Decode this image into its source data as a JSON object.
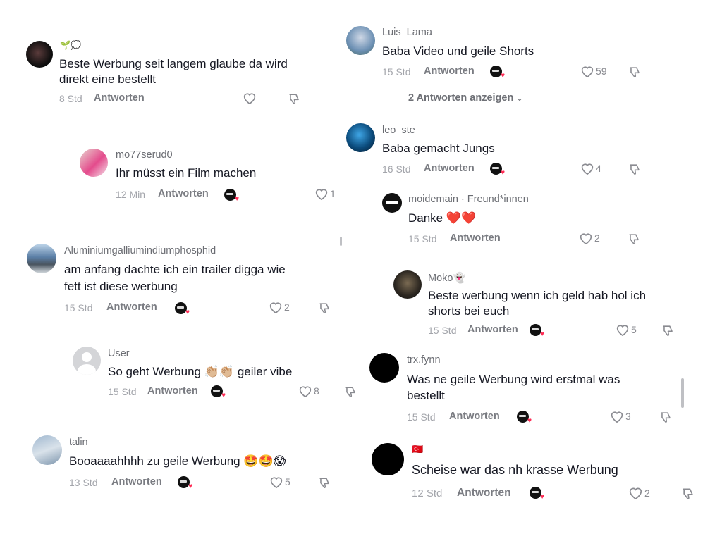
{
  "left": [
    {
      "avatar": "dark-image",
      "flag": "🌱💭",
      "name": "",
      "text1": "Beste Werbung seit langem glaube da wird",
      "text2": "direkt eine bestellt",
      "time": "8 Std",
      "reply": "Antworten",
      "likes": ""
    },
    {
      "avatar": "pink-photo",
      "name": "mo77serud0",
      "text1": "Ihr müsst ein Film machen",
      "time": "12 Min",
      "reply": "Antworten",
      "likes": "1"
    },
    {
      "avatar": "sky-photo",
      "name": "Aluminiumgalliumindiumphosphid",
      "text1": "am anfang dachte ich ein trailer digga wie",
      "text2": "fett ist diese werbung",
      "time": "15 Std",
      "reply": "Antworten",
      "likes": "2"
    },
    {
      "avatar": "default-user",
      "name": "User",
      "text1": "So geht Werbung",
      "emoji": "👏🏼👏🏼",
      "text_after": "geiler vibe",
      "time": "15 Std",
      "reply": "Antworten",
      "likes": "8"
    },
    {
      "avatar": "blue-photo",
      "name": "talin",
      "text1": "Booaaaahhhh zu geile Werbung",
      "emoji": "🤩🤩😱",
      "time": "13 Std",
      "reply": "Antworten",
      "likes": "5"
    }
  ],
  "right": [
    {
      "avatar": "person-photo",
      "name": "Luis_Lama",
      "text1": "Baba Video und geile Shorts",
      "time": "15 Std",
      "reply": "Antworten",
      "likes": "59",
      "more_replies": "2 Antworten anzeigen"
    },
    {
      "avatar": "blue-dark-photo",
      "name": "leo_ste",
      "text1": "Baba gemacht Jungs",
      "time": "16 Std",
      "reply": "Antworten",
      "likes": "4"
    },
    {
      "avatar": "brand-logo",
      "name": "moidemain",
      "tag": "· Freund*innen",
      "text1": "Danke",
      "emoji": "❤️❤️",
      "time": "15 Std",
      "reply": "Antworten",
      "likes": "2"
    },
    {
      "avatar": "dark-photo",
      "name": "Moko",
      "name_emoji": "👻",
      "text1": "Beste werbung wenn ich geld hab hol ich",
      "text2": "shorts bei euch",
      "time": "15 Std",
      "reply": "Antworten",
      "likes": "5"
    },
    {
      "avatar": "black",
      "name": "trx.fynn",
      "text1": "Was ne geile Werbung wird erstmal was",
      "text2": "bestellt",
      "time": "15 Std",
      "reply": "Antworten",
      "likes": "3"
    },
    {
      "avatar": "black",
      "flag": "🇹🇷",
      "name": "",
      "text1": "Scheise war das nh krasse Werbung",
      "time": "12 Std",
      "reply": "Antworten",
      "likes": "2"
    }
  ],
  "colors": {
    "heart": "#fe2c55",
    "meta": "#a3a5ab",
    "text": "#161823"
  }
}
